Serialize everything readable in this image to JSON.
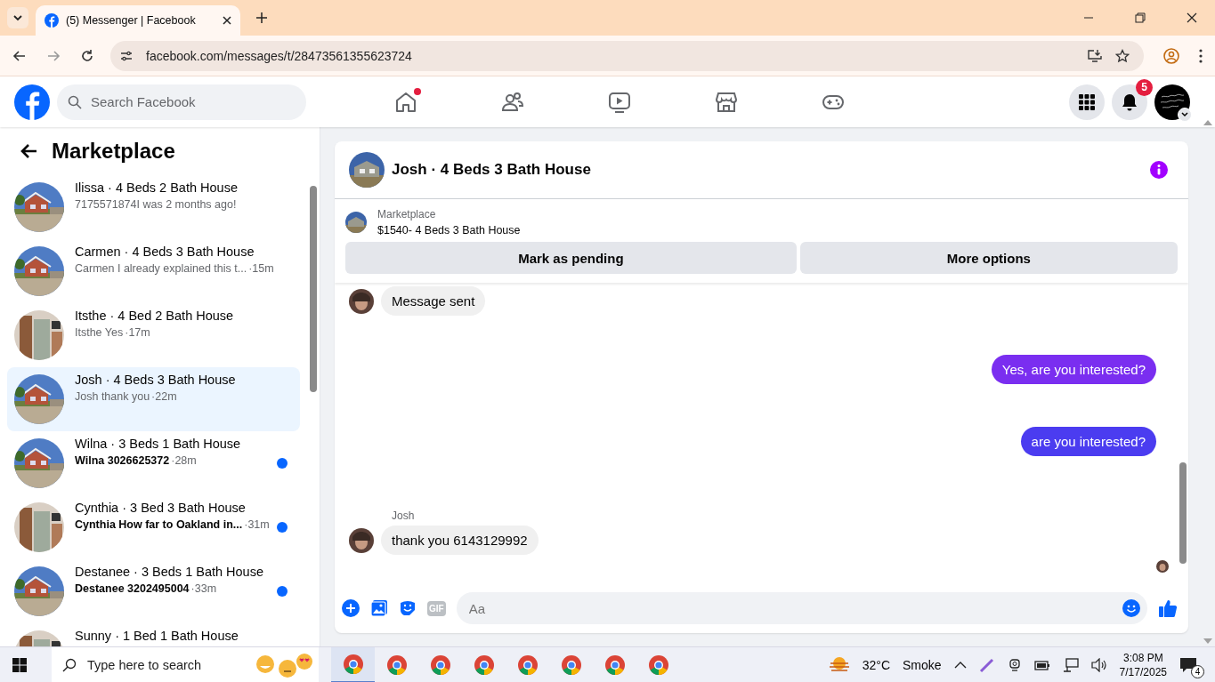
{
  "browser": {
    "tab_title": "(5) Messenger | Facebook",
    "url": "facebook.com/messages/t/28473561355623724"
  },
  "facebook": {
    "search": {
      "placeholder": "Search Facebook"
    },
    "nav": [
      {
        "kind": "home",
        "selected": false,
        "dot": true
      },
      {
        "kind": "friends",
        "selected": false,
        "dot": false
      },
      {
        "kind": "video",
        "selected": false,
        "dot": false
      },
      {
        "kind": "marketplace",
        "selected": false,
        "dot": false
      },
      {
        "kind": "gaming",
        "selected": false,
        "dot": false
      }
    ],
    "notifications_count": "5"
  },
  "sidebar": {
    "title": "Marketplace",
    "conversations": [
      {
        "title": "Ilissa · 4 Beds 2 Bath House",
        "preview": "7175571874I was 2 months ago!",
        "unread": false,
        "selected": false
      },
      {
        "title": "Carmen · 4 Beds 3 Bath House",
        "preview": "Carmen I already explained this t...",
        "time": "·15m",
        "unread": false,
        "selected": false
      },
      {
        "title": "Itsthe · 4 Bed 2 Bath House",
        "preview": "Itsthe Yes",
        "time": "·17m",
        "unread": false,
        "selected": false
      },
      {
        "title": "Josh · 4 Beds 3 Bath House",
        "preview": "Josh thank you",
        "time": "·22m",
        "unread": false,
        "selected": true
      },
      {
        "title": "Wilna · 3 Beds 1 Bath House",
        "preview": "Wilna 3026625372",
        "time": "·28m",
        "unread": true,
        "selected": false
      },
      {
        "title": "Cynthia · 3 Bed 3 Bath House",
        "preview": "Cynthia How far to Oakland in...",
        "time": "·31m",
        "unread": true,
        "selected": false
      },
      {
        "title": "Destanee · 3 Beds 1 Bath House",
        "preview": "Destanee 3202495004",
        "time": "·33m",
        "unread": true,
        "selected": false
      },
      {
        "title": "Sunny · 1 Bed 1 Bath House",
        "selected": false
      }
    ]
  },
  "chat": {
    "title": "Josh · 4 Beds 3 Bath House",
    "listing": {
      "label": "Marketplace",
      "name": "$1540- 4 Beds 3 Bath House"
    },
    "buttons": [
      "Mark as pending",
      "More options"
    ],
    "messages": [
      {
        "kind": "incoming",
        "text": "Message sent"
      },
      {
        "kind": "outgoing",
        "text": "Yes, are you interested?",
        "color": "#7a2ef0"
      },
      {
        "kind": "outgoing",
        "text": "are you  interested?",
        "color": "#4b3cf0"
      },
      {
        "kind": "incoming",
        "sender": "Josh",
        "text": "thank you 6143129992"
      }
    ],
    "composer": {
      "placeholder": "Aa",
      "gif": "GIF"
    }
  },
  "taskbar": {
    "search_placeholder": "Type here to search",
    "weather": {
      "temp": "32°C",
      "condition": "Smoke"
    },
    "time": "3:08 PM",
    "date": "7/17/2025",
    "notifications": "4"
  }
}
